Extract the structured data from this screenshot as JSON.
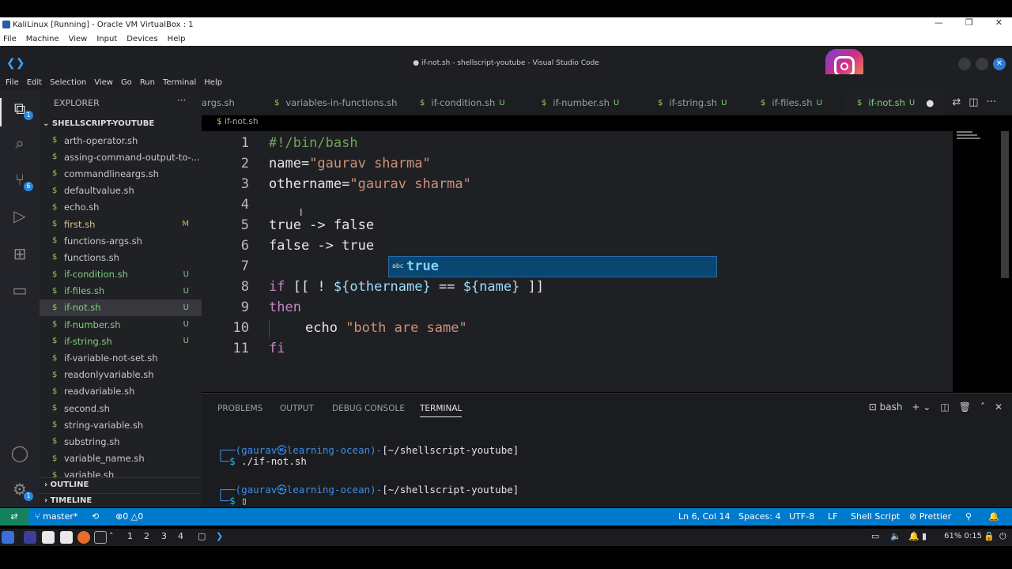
{
  "host": {
    "window_title": "KaliLinux [Running] - Oracle VM VirtualBox : 1",
    "win_min": "—",
    "win_restore": "❐",
    "win_close": "✕",
    "menu": [
      "File",
      "Machine",
      "View",
      "Input",
      "Devices",
      "Help"
    ],
    "taskbar_workspaces": [
      "1",
      "2",
      "3",
      "4"
    ],
    "battery_time": "61% 0:15"
  },
  "vscode": {
    "title": "● if-not.sh - shellscript-youtube - Visual Studio Code",
    "menu": [
      "File",
      "Edit",
      "Selection",
      "View",
      "Go",
      "Run",
      "Terminal",
      "Help"
    ],
    "activity_badges": {
      "explorer": "1",
      "source_control": "6",
      "settings": "1"
    }
  },
  "sidebar": {
    "header": "EXPLORER",
    "more": "···",
    "folder": "SHELLSCRIPT-YOUTUBE",
    "files": [
      {
        "name": "arth-operator.sh",
        "status": ""
      },
      {
        "name": "assing-command-output-to-...",
        "status": ""
      },
      {
        "name": "commandlineargs.sh",
        "status": ""
      },
      {
        "name": "defaultvalue.sh",
        "status": ""
      },
      {
        "name": "echo.sh",
        "status": ""
      },
      {
        "name": "first.sh",
        "status": "M"
      },
      {
        "name": "functions-args.sh",
        "status": ""
      },
      {
        "name": "functions.sh",
        "status": ""
      },
      {
        "name": "if-condition.sh",
        "status": "U"
      },
      {
        "name": "if-files.sh",
        "status": "U"
      },
      {
        "name": "if-not.sh",
        "status": "U"
      },
      {
        "name": "if-number.sh",
        "status": "U"
      },
      {
        "name": "if-string.sh",
        "status": "U"
      },
      {
        "name": "if-variable-not-set.sh",
        "status": ""
      },
      {
        "name": "readonlyvariable.sh",
        "status": ""
      },
      {
        "name": "readvariable.sh",
        "status": ""
      },
      {
        "name": "second.sh",
        "status": ""
      },
      {
        "name": "string-variable.sh",
        "status": ""
      },
      {
        "name": "substring.sh",
        "status": ""
      },
      {
        "name": "variable_name.sh",
        "status": ""
      },
      {
        "name": "variable.sh",
        "status": ""
      }
    ],
    "outline": "OUTLINE",
    "timeline": "TIMELINE"
  },
  "tabs": [
    {
      "name": "args.sh",
      "status": ""
    },
    {
      "name": "variables-in-functions.sh",
      "status": ""
    },
    {
      "name": "if-condition.sh",
      "status": "U"
    },
    {
      "name": "if-number.sh",
      "status": "U"
    },
    {
      "name": "if-string.sh",
      "status": "U"
    },
    {
      "name": "if-files.sh",
      "status": "U"
    },
    {
      "name": "if-not.sh",
      "status": "U"
    }
  ],
  "editor": {
    "breadcrumb": "if-not.sh",
    "line_numbers": [
      "1",
      "2",
      "3",
      "4",
      "5",
      "6",
      "7",
      "8",
      "9",
      "10",
      "11"
    ],
    "code": {
      "l1": "#!/bin/bash",
      "l2_a": "name=",
      "l2_b": "\"gaurav sharma\"",
      "l3_a": "othername=",
      "l3_b": "\"gaurav sharma\"",
      "l5": "true -> false",
      "l6": "false -> true",
      "l8_if": "if",
      "l8_a": " [[ ! ",
      "l8_b": "${othername}",
      "l8_c": " == ",
      "l8_d": "${name}",
      "l8_e": " ]]",
      "l9": "then",
      "l10_a": "echo ",
      "l10_b": "\"both are same\"",
      "l11": "fi"
    },
    "autocomplete": {
      "icon": "abc",
      "suggestion": "true"
    }
  },
  "panel": {
    "tabs": [
      "PROBLEMS",
      "OUTPUT",
      "DEBUG CONSOLE",
      "TERMINAL"
    ],
    "shell": "bash",
    "terminal": {
      "p1_user": "(gaurav㉿learning-ocean)",
      "p1_path": "[~/shellscript-youtube]",
      "p1_cmd": "./if-not.sh",
      "p2_user": "(gaurav㉿learning-ocean)",
      "p2_path": "[~/shellscript-youtube]"
    }
  },
  "statusbar": {
    "branch": "master*",
    "errors": "0",
    "warnings": "0",
    "position": "Ln 6, Col 14",
    "spaces": "Spaces: 4",
    "encoding": "UTF-8",
    "eol": "LF",
    "language": "Shell Script",
    "formatter": "Prettier"
  },
  "colors": {
    "accent": "#007acc",
    "remote": "#16825d",
    "untracked": "#7fcf7f"
  }
}
